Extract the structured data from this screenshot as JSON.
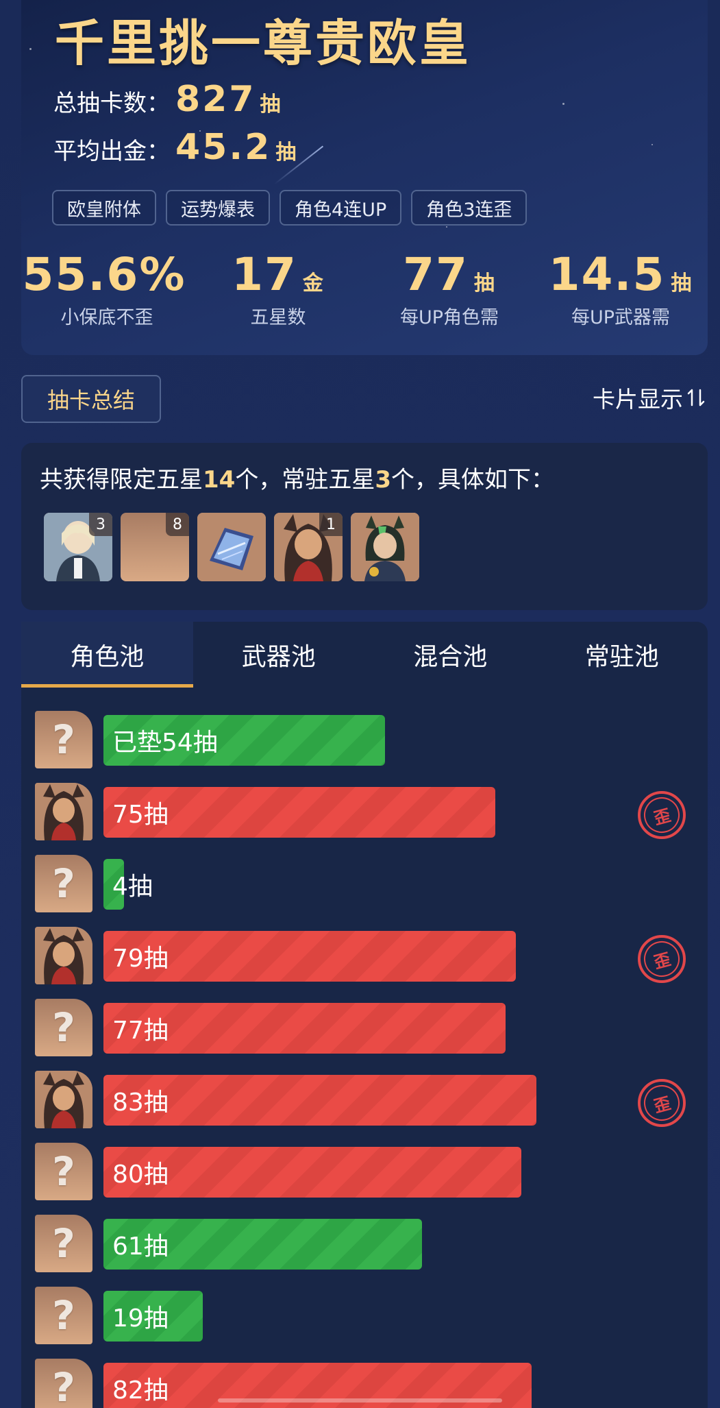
{
  "header": {
    "title": "千里挑一尊贵欧皇",
    "total_label": "总抽卡数：",
    "total_value": "827",
    "total_unit": "抽",
    "avg_label": "平均出金：",
    "avg_value": "45.2",
    "avg_unit": "抽",
    "tags": [
      "欧皇附体",
      "运势爆表",
      "角色4连UP",
      "角色3连歪"
    ]
  },
  "metrics": [
    {
      "value": "55.6%",
      "unit": "",
      "label": "小保底不歪"
    },
    {
      "value": "17",
      "unit": "金",
      "label": "五星数"
    },
    {
      "value": "77",
      "unit": "抽",
      "label": "每UP角色需"
    },
    {
      "value": "14.5",
      "unit": "抽",
      "label": "每UP武器需"
    }
  ],
  "summary": {
    "button_label": "抽卡总结",
    "card_display_label": "卡片显示",
    "card_display_icon": "sort-icon",
    "text_prefix": "共获得限定五星",
    "limited_count": "14",
    "text_mid": "个，常驻五星",
    "standard_count": "3",
    "text_suffix": "个，具体如下：",
    "avatars": [
      {
        "name": "character-avatar-1",
        "count": "3"
      },
      {
        "name": "character-avatar-2",
        "count": "8"
      },
      {
        "name": "weapon-avatar",
        "count": ""
      },
      {
        "name": "character-avatar-3",
        "count": "1"
      },
      {
        "name": "character-avatar-4",
        "count": ""
      }
    ]
  },
  "tabs": [
    "角色池",
    "武器池",
    "混合池",
    "常驻池"
  ],
  "active_tab": 0,
  "pulls": [
    {
      "label": "已垫54抽",
      "value": 54,
      "color": "green",
      "avatar": "unknown",
      "off_banner": false
    },
    {
      "label": "75抽",
      "value": 75,
      "color": "red",
      "avatar": "character",
      "off_banner": true
    },
    {
      "label": "4抽",
      "value": 4,
      "color": "green",
      "avatar": "unknown",
      "off_banner": false
    },
    {
      "label": "79抽",
      "value": 79,
      "color": "red",
      "avatar": "character",
      "off_banner": true
    },
    {
      "label": "77抽",
      "value": 77,
      "color": "red",
      "avatar": "unknown",
      "off_banner": false
    },
    {
      "label": "83抽",
      "value": 83,
      "color": "red",
      "avatar": "character",
      "off_banner": true
    },
    {
      "label": "80抽",
      "value": 80,
      "color": "red",
      "avatar": "unknown",
      "off_banner": false
    },
    {
      "label": "61抽",
      "value": 61,
      "color": "green",
      "avatar": "unknown",
      "off_banner": false
    },
    {
      "label": "19抽",
      "value": 19,
      "color": "green",
      "avatar": "unknown",
      "off_banner": false
    },
    {
      "label": "82抽",
      "value": 82,
      "color": "red",
      "avatar": "unknown",
      "off_banner": false
    }
  ],
  "badge_text": "歪",
  "unknown_symbol": "?",
  "colors": {
    "gold": "#fbd68a",
    "green": "#37b24d",
    "red": "#ea4b46",
    "accent": "#e6a94a"
  }
}
